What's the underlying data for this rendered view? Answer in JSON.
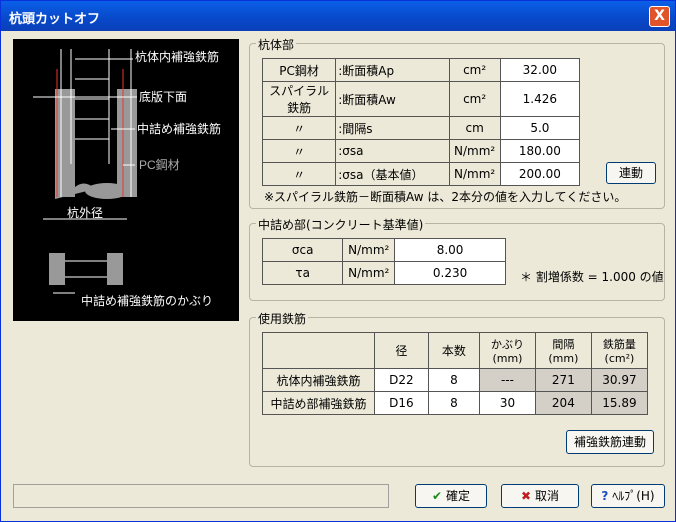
{
  "window": {
    "title": "杭頭カットオフ",
    "close": "X"
  },
  "diagram": {
    "labels": {
      "reinforce": "杭体内補強鉄筋",
      "slab": "底版下面",
      "inner": "中詰め補強鉄筋",
      "pc": "PC鋼材",
      "diameter": "杭外径",
      "cover": "中詰め補強鉄筋のかぶり"
    }
  },
  "pile": {
    "title": "杭体部",
    "rows": [
      {
        "name": "PC鋼材",
        "prop": ":断面積Ap",
        "unit": "cm²",
        "value": "32.00"
      },
      {
        "name": "スパイラル鉄筋",
        "prop": ":断面積Aw",
        "unit": "cm²",
        "value": "1.426"
      },
      {
        "name": "〃",
        "prop": ":間隔s",
        "unit": "cm",
        "value": "5.0"
      },
      {
        "name": "〃",
        "prop": ":σsa",
        "unit": "N/mm²",
        "value": "180.00"
      },
      {
        "name": "〃",
        "prop": ":σsa（基本値）",
        "unit": "N/mm²",
        "value": "200.00"
      }
    ],
    "link_button": "連動",
    "note": "※スパイラル鉄筋－断面積Aw は、2本分の値を入力してください。"
  },
  "concrete": {
    "title": "中詰め部(コンクリート基準値)",
    "rows": [
      {
        "name": "σca",
        "unit": "N/mm²",
        "value": "8.00"
      },
      {
        "name": "τa",
        "unit": "N/mm²",
        "value": "0.230"
      }
    ],
    "note": "＊ 割増係数 = 1.000 の値"
  },
  "rebar": {
    "title": "使用鉄筋",
    "headers": [
      "径",
      "本数",
      "かぶり\n(mm)",
      "間隔\n(mm)",
      "鉄筋量\n(cm²)"
    ],
    "rows": [
      {
        "name": "杭体内補強鉄筋",
        "dia": "D22",
        "count": "8",
        "cover": "---",
        "spacing": "271",
        "area": "30.97"
      },
      {
        "name": "中詰め部補強鉄筋",
        "dia": "D16",
        "count": "8",
        "cover": "30",
        "spacing": "204",
        "area": "15.89"
      }
    ],
    "link_button": "補強鉄筋連動"
  },
  "footer": {
    "ok": "確定",
    "cancel": "取消",
    "help": "ﾍﾙﾌﾟ(H)"
  }
}
